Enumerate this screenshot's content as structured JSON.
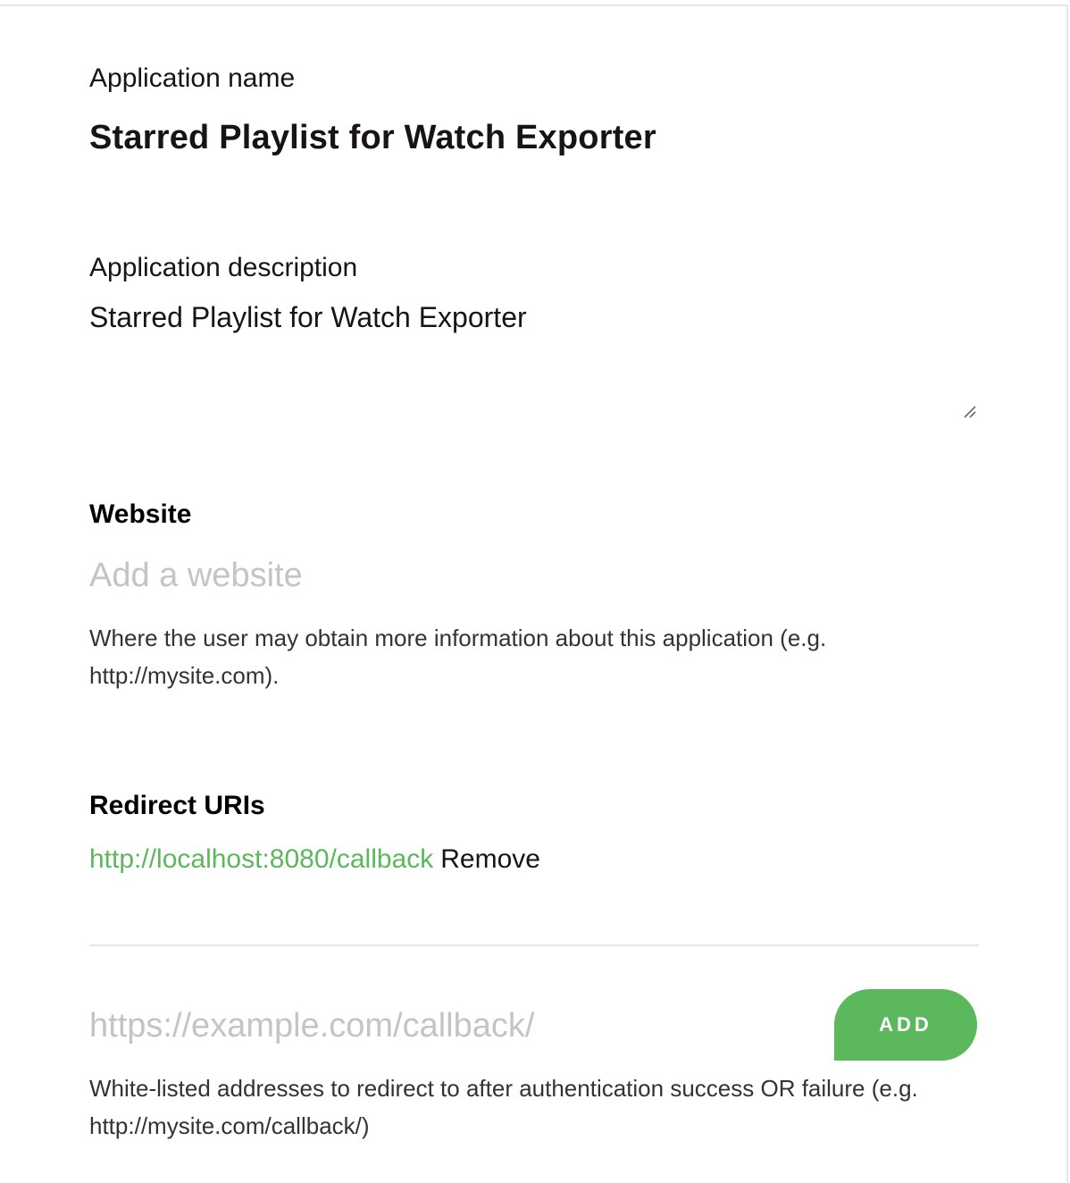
{
  "application": {
    "name_label": "Application name",
    "name_value": "Starred Playlist for Watch Exporter",
    "description_label": "Application description",
    "description_value": "Starred Playlist for Watch Exporter"
  },
  "website": {
    "heading": "Website",
    "placeholder": "Add a website",
    "value": "",
    "help": "Where the user may obtain more information about this application (e.g. http://mysite.com)."
  },
  "redirect_uris": {
    "heading": "Redirect URIs",
    "items": [
      {
        "uri": "http://localhost:8080/callback",
        "remove_label": "Remove"
      }
    ],
    "new_uri_placeholder": "https://example.com/callback/",
    "add_label": "ADD",
    "help": "White-listed addresses to redirect to after authentication success OR failure (e.g. http://mysite.com/callback/)"
  },
  "colors": {
    "accent_green": "#5cb85c",
    "placeholder_gray": "#c4c4c4",
    "divider_gray": "#e6e6e6"
  },
  "icons": {
    "resize_handle": "textarea-resize-icon"
  }
}
